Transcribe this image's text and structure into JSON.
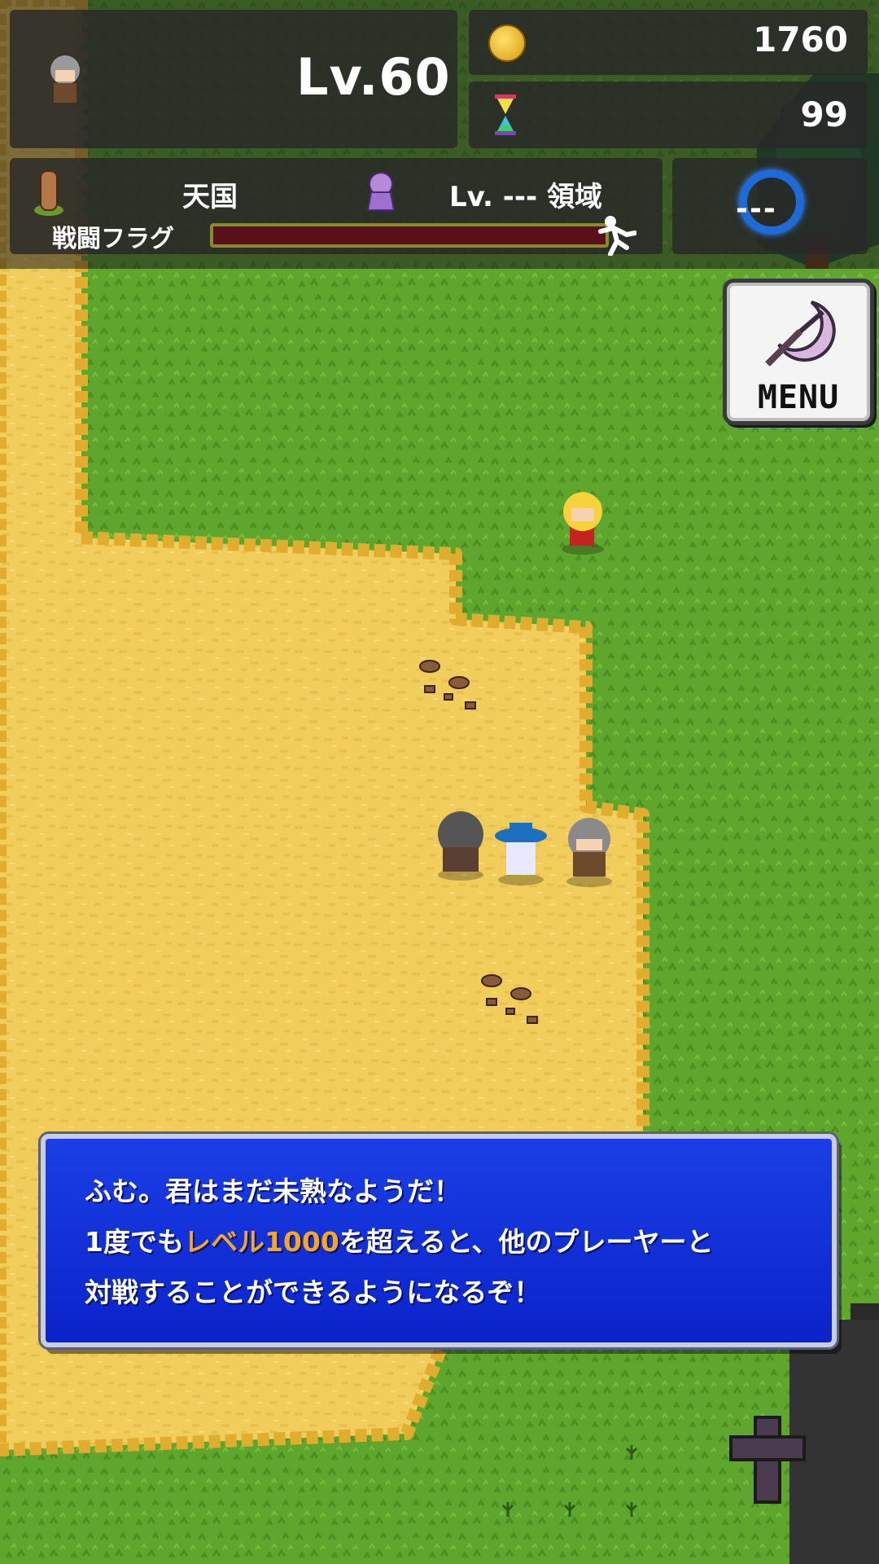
{
  "hud": {
    "level": "Lv.60",
    "gold": "1760",
    "hourglass": "99",
    "area_name": "天国",
    "domain_label": "Lv. --- 領域",
    "battle_flag_label": "戦闘フラグ",
    "battle_flag_progress": 1.0,
    "portal_text": "---"
  },
  "menu": {
    "label": "MENU"
  },
  "dialog": {
    "line1": "ふむ。君はまだ未熟なようだ！",
    "line2_pre": "1度でも",
    "line2_highlight": "レベル1000",
    "line2_post": "を超えると、他のプレーヤーと",
    "line3": "対戦することができるようになるぞ！"
  },
  "colors": {
    "grass": "#5fa62e",
    "sand": "#f1cd5c",
    "sand_edge": "#e0ad2f",
    "dialog_blue": "#1233dd",
    "highlight": "#f5a623"
  }
}
